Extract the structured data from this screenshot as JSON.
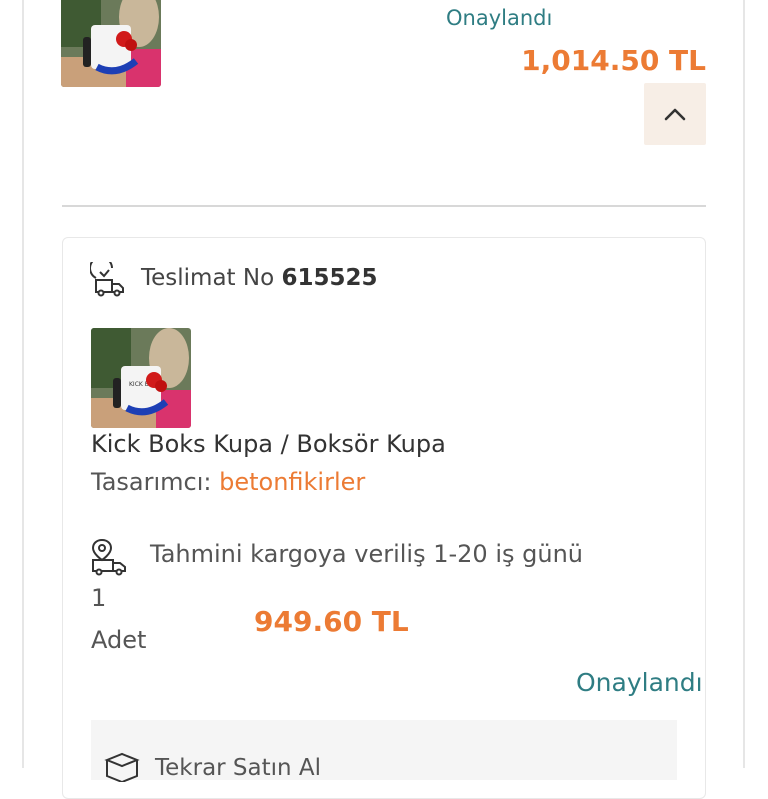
{
  "previous_order": {
    "status": "Onaylandı",
    "total_price": "1,014.50 TL",
    "collapse_icon": "chevron-up-icon"
  },
  "delivery": {
    "label": "Teslimat No",
    "number": "615525",
    "icon": "delivery-truck-icon"
  },
  "product": {
    "name": "Kick Boks Kupa / Boksör Kupa",
    "designer_label": "Tasarımcı:",
    "designer_name": "betonfikirler",
    "mug_text": "KICK BOKS"
  },
  "shipping": {
    "text": "Tahmini kargoya veriliş 1-20 iş günü",
    "icon": "shipping-location-icon"
  },
  "quantity": {
    "value": "1",
    "unit": "Adet"
  },
  "item_price": "949.60 TL",
  "item_status": "Onaylandı",
  "sub_panel": {
    "text": "Tekrar Satın Al",
    "icon": "box-icon"
  },
  "colors": {
    "accent_orange": "#ec7b34",
    "status_teal": "#2f7d83",
    "button_bg": "#f7eee6"
  }
}
